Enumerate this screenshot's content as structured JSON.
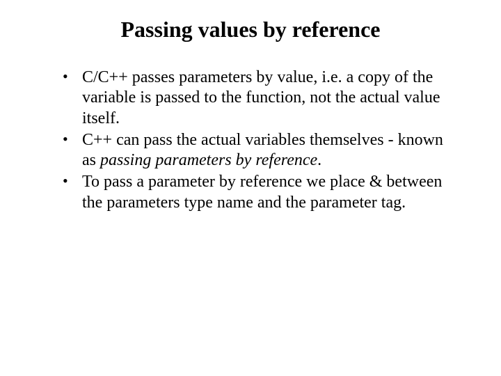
{
  "title": "Passing values by reference",
  "bullets": [
    {
      "spans": [
        {
          "text": "C/C++ passes parameters by value, i.e. a copy of the variable is passed to the function, not the actual value itself.",
          "italic": false
        }
      ]
    },
    {
      "spans": [
        {
          "text": "C++ can pass the actual variables themselves - known as ",
          "italic": false
        },
        {
          "text": "passing parameters by reference",
          "italic": true
        },
        {
          "text": ".",
          "italic": false
        }
      ]
    },
    {
      "spans": [
        {
          "text": "To pass a parameter by reference we place & between the parameters type name and the parameter tag.",
          "italic": false
        }
      ]
    }
  ]
}
